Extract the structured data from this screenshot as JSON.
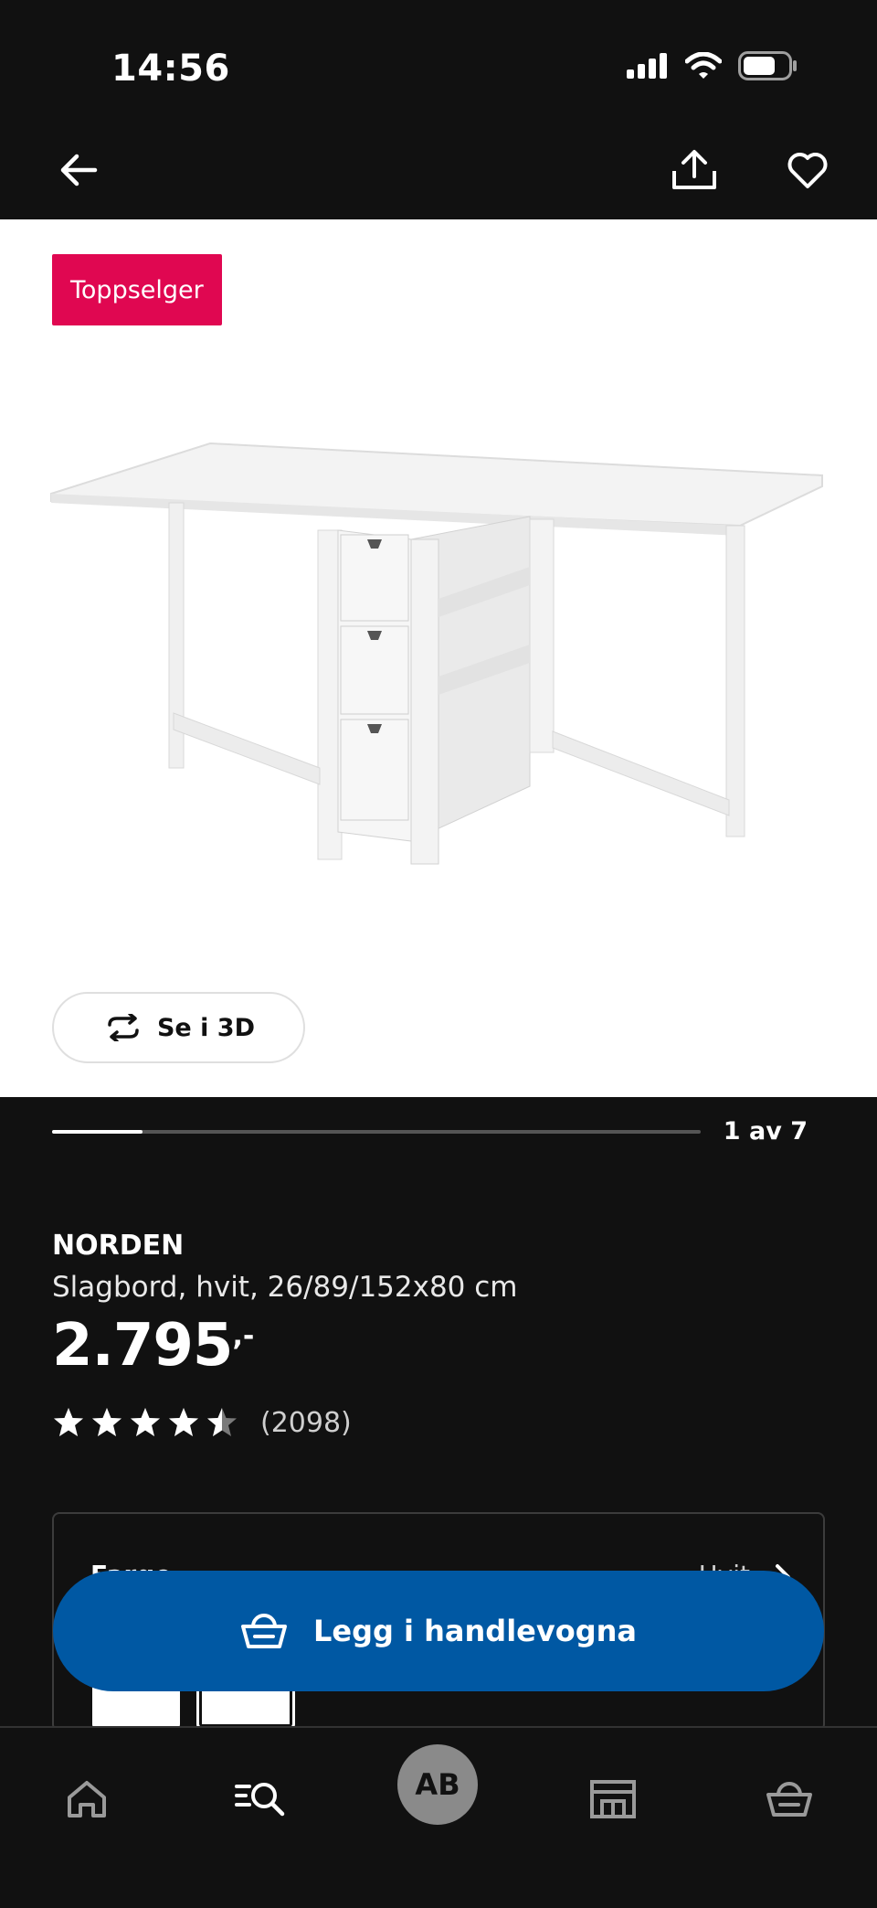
{
  "status_bar": {
    "time": "14:56"
  },
  "media": {
    "badge": "Toppselger",
    "view_3d_label": "Se i 3D",
    "gallery_counter": "1 av 7",
    "gallery_progress": 0.14
  },
  "product": {
    "name": "NORDEN",
    "description": "Slagbord, hvit, 26/89/152x80 cm",
    "price": "2.795",
    "price_suffix": ",-",
    "rating": 4.5,
    "review_count": "(2098)"
  },
  "variant": {
    "label": "Farge",
    "value": "Hvit"
  },
  "cta": {
    "add_to_cart": "Legg i handlevogna"
  },
  "bottom_nav": {
    "items": [
      "home-icon",
      "search-icon",
      "account-avatar",
      "store-icon",
      "cart-icon"
    ],
    "avatar_initials": "AB"
  }
}
